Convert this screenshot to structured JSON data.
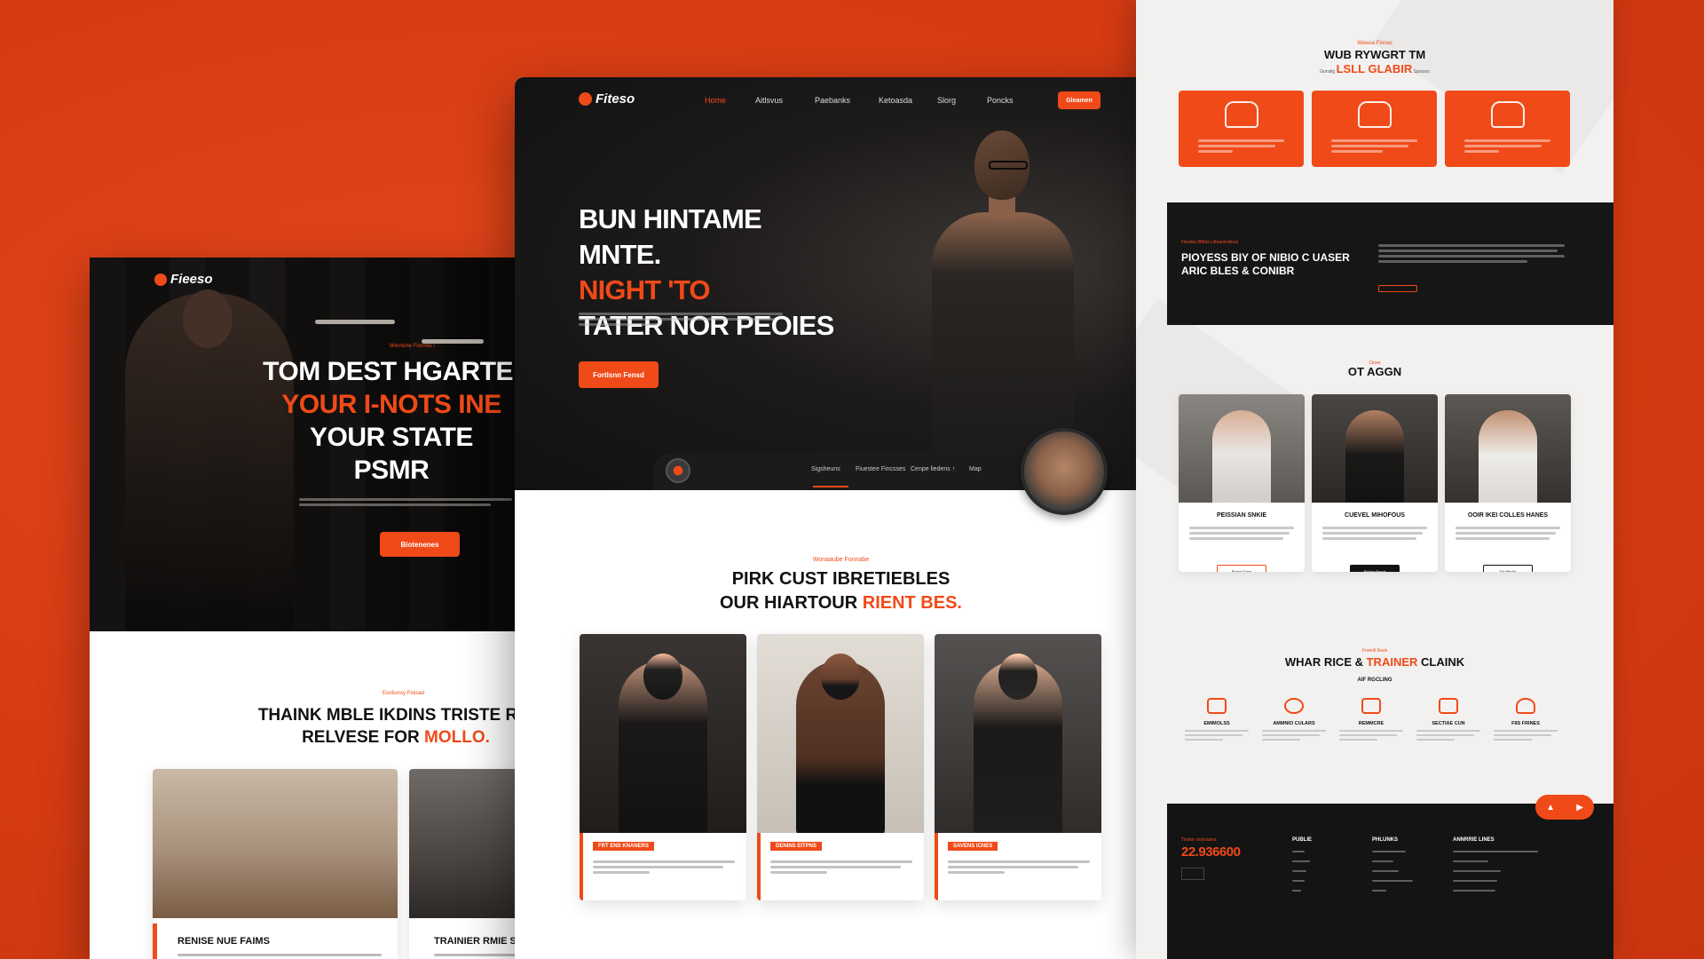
{
  "colors": {
    "background": "#d83d14",
    "accent": "#f04a18",
    "dark": "#161616",
    "light": "#f2f1f0"
  },
  "left": {
    "logo": "Fieeso",
    "hero": {
      "eyebrow": "Wieniuhe Fionnes !",
      "title_lines": [
        "TOM DEST HGARTEI",
        "YOUR I-NOTS INE",
        "YOUR STATE",
        "PSMR"
      ],
      "button": "Biotenenes"
    },
    "section": {
      "eyebrow": "Exotiunsy Finisad",
      "title_line1": "THAINK MBLE IKDINS TRISTE RIX",
      "title_line2_prefix": "RELVESE FOR ",
      "title_line2_accent": "MOLLO."
    },
    "cards": [
      {
        "caption": "RENISE NUE FAIMS"
      },
      {
        "caption": "TRAINIER RMIE S"
      }
    ]
  },
  "center": {
    "logo": "Fiteso",
    "nav": [
      "Home",
      "Aitlsvus",
      "Paebanks",
      "Ketoasda",
      "Slorg",
      "Poncks"
    ],
    "nav_button": "Gleamen",
    "hero": {
      "title_line1": "BUN HINTAME",
      "title_line2_prefix": "MNTE. ",
      "title_line2_accent": "NIGHT 'TO",
      "title_line3": "TATER NOR PEOIES",
      "button": "Fortlsnn Fensd"
    },
    "subnav": [
      "Sigsheuns",
      "Fiuestee Fincsses",
      "Cenpe liedens ↑",
      "Map"
    ],
    "section": {
      "eyebrow": "Wonaaube Fonnabe",
      "title_line1": "PIRK CUST IBRETIEBLES",
      "title_line2_prefix": "OUR HIARTOUR ",
      "title_line2_accent": "RIENT BES."
    },
    "trainers": [
      {
        "tag": "FRT ENS KNANERS"
      },
      {
        "tag": "DENINS EITPNS"
      },
      {
        "tag": "SAVENS ICNES"
      }
    ]
  },
  "right": {
    "s1": {
      "eyebrow": "Wewoa Finnes",
      "title_line1": "WUB RYWGRT TM",
      "title_line2_prefix": "Gonsllg ",
      "title_line2_accent": "LSLL GLABIR",
      "title_line2_suffix": " Spossrs"
    },
    "dark": {
      "eyebrow": "Flewbis fiMbla Llifaanmdmus",
      "title_line1": "PIOYESS BIY OF NIBIO C UASER",
      "title_line2": "ARIC BLES & CONIBR"
    },
    "team": {
      "eyebrow": "Cinee",
      "title": "OT AGGN",
      "members": [
        {
          "name": "PEISSIAN SNKIE",
          "button": "Brusni Fuise"
        },
        {
          "name": "CUEVEL MIHOFOUS",
          "button": "Biri4ea Peunli"
        },
        {
          "name": "OOIR IKEI COLLES HANES",
          "button": "Sai Bleuits"
        }
      ]
    },
    "why": {
      "eyebrow": "Forentl Ilsuis",
      "title_prefix": "WHAR RICE & ",
      "title_accent": "TRAINER",
      "title_suffix": " CLAINK",
      "subtitle": "AIF RGCLING",
      "items": [
        {
          "label": "EMIMOLSS"
        },
        {
          "label": "AMMNIO CULARS"
        },
        {
          "label": "REMMCRE"
        },
        {
          "label": "SECTIAE CUN"
        },
        {
          "label": "FIIS FRINES"
        }
      ]
    },
    "fabs": [
      "▲",
      "▶"
    ],
    "footer": {
      "phone_label": "Tiostor vsoisasisa",
      "phone": "22.936600",
      "columns": [
        {
          "title": "PUBLIE"
        },
        {
          "title": "PHLUNKS"
        },
        {
          "title": "ANNRRIE LINES"
        }
      ]
    }
  }
}
